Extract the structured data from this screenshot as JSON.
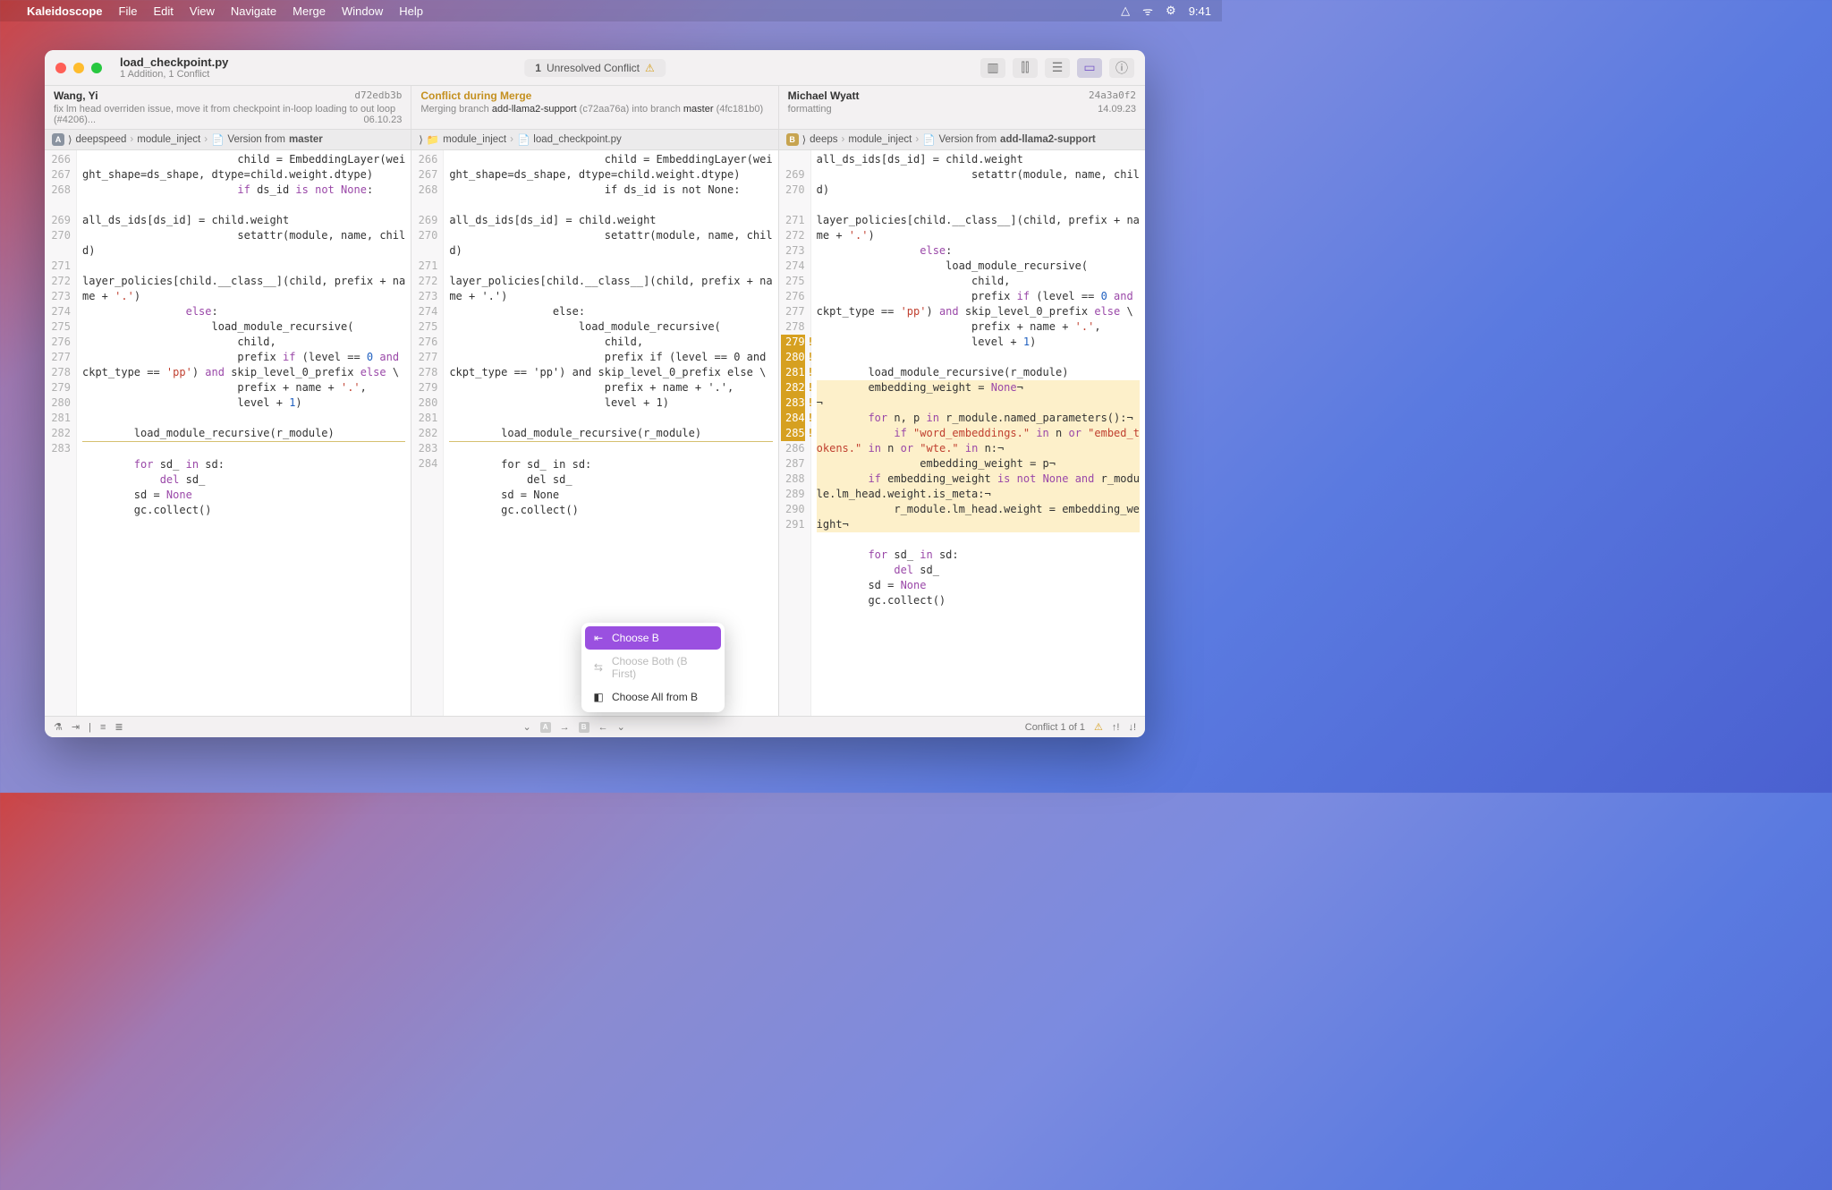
{
  "menubar": {
    "app": "Kaleidoscope",
    "items": [
      "File",
      "Edit",
      "View",
      "Navigate",
      "Merge",
      "Window",
      "Help"
    ],
    "clock": "9:41"
  },
  "titlebar": {
    "filename": "load_checkpoint.py",
    "subtitle": "1 Addition, 1 Conflict",
    "center_count": "1",
    "center_label": "Unresolved Conflict"
  },
  "info": {
    "left": {
      "author": "Wang, Yi",
      "hash": "d72edb3b",
      "desc": "fix lm head overriden issue, move it from checkpoint in-loop loading to out loop (#4206)...",
      "date": "06.10.23"
    },
    "center": {
      "title": "Conflict during Merge",
      "desc_pre": "Merging branch ",
      "branch1": "add-llama2-support",
      "hash1": "(c72aa76a)",
      "mid": " into branch ",
      "branch2": "master",
      "hash2": "(4fc181b0)"
    },
    "right": {
      "author": "Michael Wyatt",
      "hash": "24a3a0f2",
      "desc": "formatting",
      "date": "14.09.23"
    }
  },
  "breadcrumbs": {
    "left": {
      "badge": "A",
      "folder": "deepspeed",
      "sub": "module_inject",
      "file_pre": "Version from ",
      "file_b": "master"
    },
    "center": {
      "folder": "module_inject",
      "file": "load_checkpoint.py"
    },
    "right": {
      "badge": "B",
      "folder": "deeps",
      "sub": "module_inject",
      "file_pre": "Version from ",
      "file_b": "add-llama2-support"
    }
  },
  "popup": {
    "choose_b": "Choose B",
    "choose_both": "Choose Both (B First)",
    "choose_all": "Choose All from B"
  },
  "footer": {
    "status": "Conflict 1 of 1"
  },
  "code": {
    "left": [
      {
        "n": "266",
        "t": "                        child = EmbeddingLayer(weight_shape=ds_shape, dtype=child.weight.dtype)"
      },
      {
        "n": "267",
        "t": "                        <kw>if</kw> ds_id <op>is</op> <op>not</op> <none>None</none>:"
      },
      {
        "n": "268",
        "t": ""
      },
      {
        "n": "",
        "t": "all_ds_ids[ds_id] = child.weight"
      },
      {
        "n": "269",
        "t": "                        setattr(module, name, child)"
      },
      {
        "n": "270",
        "t": ""
      },
      {
        "n": "",
        "t": "layer_policies[child.__class__](child, prefix + name + <str>'.'</str>)"
      },
      {
        "n": "271",
        "t": "                <kw>else</kw>:"
      },
      {
        "n": "272",
        "t": "                    load_module_recursive("
      },
      {
        "n": "273",
        "t": "                        child,"
      },
      {
        "n": "274",
        "t": "                        prefix <kw>if</kw> (level == <num>0</num> <op>and</op> ckpt_type == <str>'pp'</str>) <op>and</op> skip_level_0_prefix <kw>else</kw> \\"
      },
      {
        "n": "275",
        "t": "                        prefix + name + <str>'.'</str>,"
      },
      {
        "n": "276",
        "t": "                        level + <num>1</num>)"
      },
      {
        "n": "277",
        "t": ""
      },
      {
        "n": "278",
        "t": "        load_module_recursive(r_module)",
        "sep": true
      },
      {
        "n": "279",
        "t": "",
        "hi": false
      },
      {
        "n": "280",
        "t": "        <kw>for</kw> sd_ <op>in</op> sd:"
      },
      {
        "n": "281",
        "t": "            <kw>del</kw> sd_"
      },
      {
        "n": "282",
        "t": "        sd = <none>None</none>"
      },
      {
        "n": "283",
        "t": "        gc.collect()"
      }
    ],
    "center": [
      {
        "n": "266",
        "t": "                        child = EmbeddingLayer(weight_shape=ds_shape, dtype=child.weight.dtype)"
      },
      {
        "n": "267",
        "t": "                        if ds_id is not None:"
      },
      {
        "n": "268",
        "t": ""
      },
      {
        "n": "",
        "t": "all_ds_ids[ds_id] = child.weight"
      },
      {
        "n": "269",
        "t": "                        setattr(module, name, child)"
      },
      {
        "n": "270",
        "t": ""
      },
      {
        "n": "",
        "t": "layer_policies[child.__class__](child, prefix + name + '.')"
      },
      {
        "n": "271",
        "t": "                else:"
      },
      {
        "n": "272",
        "t": "                    load_module_recursive("
      },
      {
        "n": "273",
        "t": "                        child,"
      },
      {
        "n": "274",
        "t": "                        prefix if (level == 0 and ckpt_type == 'pp') and skip_level_0_prefix else \\"
      },
      {
        "n": "275",
        "t": "                        prefix + name + '.',"
      },
      {
        "n": "276",
        "t": "                        level + 1)"
      },
      {
        "n": "277",
        "t": ""
      },
      {
        "n": "278",
        "t": "        load_module_recursive(r_module)",
        "sep": true
      },
      {
        "n": "279",
        "t": ""
      },
      {
        "n": "280",
        "t": "        for sd_ in sd:"
      },
      {
        "n": "281",
        "t": "            del sd_"
      },
      {
        "n": "282",
        "t": "        sd = None"
      },
      {
        "n": "283",
        "t": "        gc.collect()"
      },
      {
        "n": "284",
        "t": ""
      }
    ],
    "right": [
      {
        "n": "",
        "t": "all_ds_ids[ds_id] = child.weight"
      },
      {
        "n": "269",
        "t": "                        setattr(module, name, child)"
      },
      {
        "n": "270",
        "t": ""
      },
      {
        "n": "",
        "t": "layer_policies[child.__class__](child, prefix + name + <str>'.'</str>)"
      },
      {
        "n": "271",
        "t": "                <kw>else</kw>:"
      },
      {
        "n": "272",
        "t": "                    load_module_recursive("
      },
      {
        "n": "273",
        "t": "                        child,"
      },
      {
        "n": "274",
        "t": "                        prefix <kw>if</kw> (level == <num>0</num> <op>and</op> ckpt_type == <str>'pp'</str>) <op>and</op> skip_level_0_prefix <kw>else</kw> \\"
      },
      {
        "n": "275",
        "t": "                        prefix + name + <str>'.'</str>,"
      },
      {
        "n": "276",
        "t": "                        level + <num>1</num>)"
      },
      {
        "n": "277",
        "t": ""
      },
      {
        "n": "278",
        "t": "        load_module_recursive(r_module)"
      },
      {
        "n": "279",
        "t": "        embedding_weight = <none>None</none>¬",
        "hi": true
      },
      {
        "n": "280",
        "t": "¬",
        "hi": true
      },
      {
        "n": "281",
        "t": "        <kw>for</kw> n, p <op>in</op> r_module.named_parameters():¬",
        "hi": true
      },
      {
        "n": "282",
        "t": "            <kw>if</kw> <str>\"word_embeddings.\"</str> <op>in</op> n <op>or</op> <str>\"embed_tokens.\"</str> <op>in</op> n <op>or</op> <str>\"wte.\"</str> <op>in</op> n:¬",
        "hi": true
      },
      {
        "n": "283",
        "t": "                embedding_weight = p¬",
        "hi": true
      },
      {
        "n": "284",
        "t": "        <kw>if</kw> embedding_weight <op>is</op> <op>not</op> <none>None</none> <op>and</op> r_module.lm_head.weight.is_meta:¬",
        "hi": true
      },
      {
        "n": "285",
        "t": "            r_module.lm_head.weight = embedding_weight¬",
        "hi": true
      },
      {
        "n": "286",
        "t": ""
      },
      {
        "n": "287",
        "t": "        <kw>for</kw> sd_ <op>in</op> sd:"
      },
      {
        "n": "288",
        "t": "            <kw>del</kw> sd_"
      },
      {
        "n": "289",
        "t": "        sd = <none>None</none>"
      },
      {
        "n": "290",
        "t": "        gc.collect()"
      },
      {
        "n": "291",
        "t": ""
      }
    ]
  }
}
